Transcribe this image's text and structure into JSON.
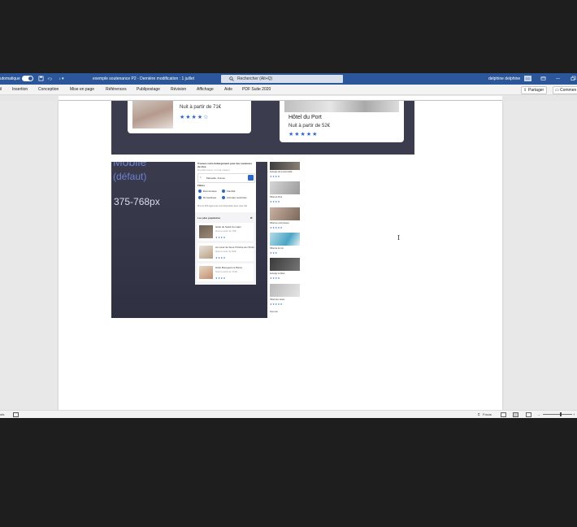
{
  "titlebar": {
    "autosave_label": "utomatique",
    "doc_title": "exemple soutenance P2  -  Dernière modification : 1 juillet",
    "search_placeholder": "Rechercher (Alt+Q)",
    "user_name": "delphine delphine",
    "avatar_initials": "DD"
  },
  "ribbon": {
    "tabs": [
      "il",
      "Insertion",
      "Conception",
      "Mise en page",
      "Références",
      "Publipostage",
      "Révision",
      "Affichage",
      "Aide",
      "PDF Suite 2020"
    ],
    "share_label": "Partager",
    "comments_label": "Commen"
  },
  "slide1": {
    "card_left": {
      "price": "Nuit à partir de 71€",
      "stars": "★★★★☆"
    },
    "card_right": {
      "name": "Hôtel du Port",
      "price": "Nuit à partir de 52€",
      "stars": "★★★★★"
    }
  },
  "slide2": {
    "title_partial": "Mobile",
    "default_label": "(défaut)",
    "range": "375-768px",
    "phone": {
      "heading": "Trouvez votre hébergement pour des vacances de rêve",
      "subheading": "En plein cœur, on a la maison.",
      "location": "Marseille, France",
      "filters_label": "Filtres",
      "filters": [
        "Économique",
        "Familial",
        "Romantique",
        "Animaux autorisés"
      ],
      "info_text": "Plus de 500 logements sont disponibles dans cette ville",
      "popular_heading": "Les plus populaires",
      "popular": [
        {
          "name": "Hôtel du Soleil du matin",
          "price": "Nuit à partir de 76€",
          "stars": "★★★★"
        },
        {
          "name": "Au cœur de Sous l'Ombre de l'Ontin",
          "price": "Nuit à partir de 90€",
          "stars": "★★★★"
        },
        {
          "name": "Hôtel Bourgeois le Barco",
          "price": "Nuit à partir de 112€",
          "stars": "★★★★"
        }
      ]
    },
    "strip": [
      {
        "name": "Auberge de la Grenouille",
        "stars": "★★★★"
      },
      {
        "name": "Hôtel au Pont",
        "stars": "★★★★"
      },
      {
        "name": "Hôtel les nuits bleues",
        "stars": "★★★★★"
      },
      {
        "name": "Hôtel de la mer",
        "stars": "★★★"
      },
      {
        "name": "Auberge le Rêve",
        "stars": "★★★★"
      },
      {
        "name": "Hôtel bien rester",
        "stars": "★★★★★"
      }
    ],
    "strip_footer": "Marseille"
  },
  "statusbar": {
    "left": "ots",
    "focus_label": "Focus"
  },
  "colors": {
    "word_blue": "#2b579a",
    "slide_bg": "#3b3d4e",
    "star_blue": "#2f67c9"
  }
}
